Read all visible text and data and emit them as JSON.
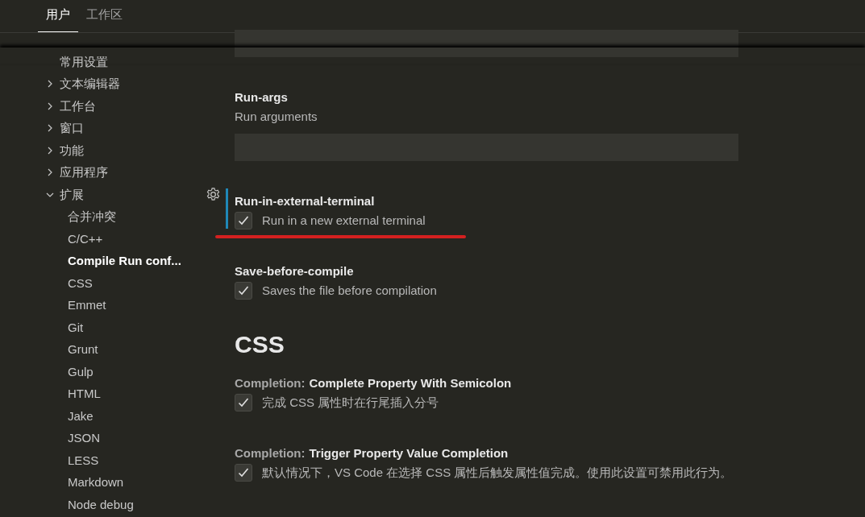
{
  "tabs": [
    {
      "label": "用户",
      "selected": true
    },
    {
      "label": "工作区",
      "selected": false
    }
  ],
  "sidebar": {
    "items": [
      {
        "label": "常用设置",
        "selected": false
      },
      {
        "label": "文本编辑器",
        "expanded": false,
        "selected": false
      },
      {
        "label": "工作台",
        "expanded": false,
        "selected": false
      },
      {
        "label": "窗口",
        "expanded": false,
        "selected": false
      },
      {
        "label": "功能",
        "expanded": false,
        "selected": false
      },
      {
        "label": "应用程序",
        "expanded": false,
        "selected": false
      },
      {
        "label": "扩展",
        "expanded": true,
        "selected": false,
        "children": [
          {
            "label": "合并冲突",
            "selected": false
          },
          {
            "label": "C/C++",
            "selected": false
          },
          {
            "label": "Compile Run conf...",
            "selected": true
          },
          {
            "label": "CSS",
            "selected": false
          },
          {
            "label": "Emmet",
            "selected": false
          },
          {
            "label": "Git",
            "selected": false
          },
          {
            "label": "Grunt",
            "selected": false
          },
          {
            "label": "Gulp",
            "selected": false
          },
          {
            "label": "HTML",
            "selected": false
          },
          {
            "label": "Jake",
            "selected": false
          },
          {
            "label": "JSON",
            "selected": false
          },
          {
            "label": "LESS",
            "selected": false
          },
          {
            "label": "Markdown",
            "selected": false
          },
          {
            "label": "Node debug",
            "selected": false
          }
        ]
      }
    ]
  },
  "settings": [
    {
      "kind": "cut_field"
    },
    {
      "kind": "text",
      "title": "Run-args",
      "description": "Run arguments",
      "focused": false,
      "underlined": false
    },
    {
      "kind": "checkbox",
      "title": "Run-in-external-terminal",
      "description": "Run in a new external terminal",
      "checked": true,
      "focused": true,
      "underlined": true
    },
    {
      "kind": "checkbox",
      "title": "Save-before-compile",
      "description": "Saves the file before compilation",
      "checked": true,
      "focused": false,
      "underlined": false
    },
    {
      "kind": "heading",
      "title": "CSS"
    },
    {
      "kind": "checkbox",
      "category": "Completion:",
      "title": "Complete Property With Semicolon",
      "description": "完成 CSS 属性时在行尾插入分号",
      "checked": true,
      "focused": false,
      "underlined": false
    },
    {
      "kind": "checkbox",
      "category": "Completion:",
      "title": "Trigger Property Value Completion",
      "description": "默认情况下，VS Code 在选择 CSS 属性后触发属性值完成。使用此设置可禁用此行为。",
      "checked": true,
      "focused": false,
      "underlined": false
    }
  ]
}
